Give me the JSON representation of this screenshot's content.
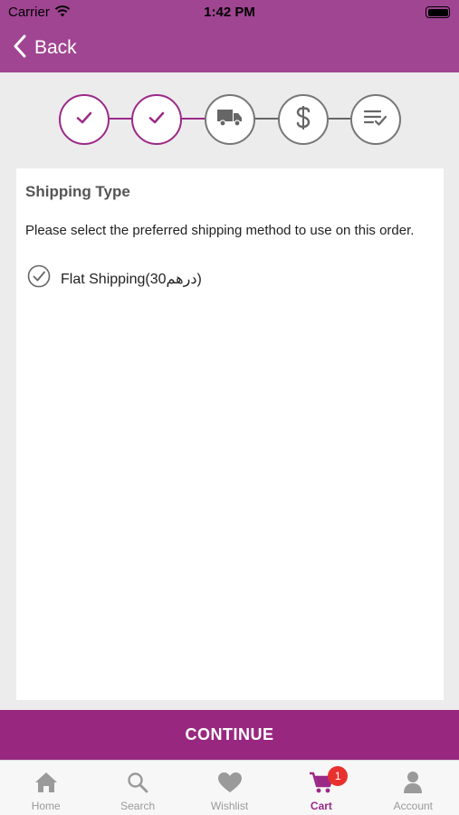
{
  "status_bar": {
    "carrier": "Carrier",
    "time": "1:42 PM"
  },
  "nav": {
    "back_label": "Back"
  },
  "stepper": {
    "steps": [
      {
        "name": "step-address",
        "icon": "check-icon",
        "state": "done"
      },
      {
        "name": "step-delivery",
        "icon": "check-icon",
        "state": "done"
      },
      {
        "name": "step-shipping",
        "icon": "truck-icon",
        "state": "pending"
      },
      {
        "name": "step-payment",
        "icon": "dollar-icon",
        "state": "pending"
      },
      {
        "name": "step-review",
        "icon": "checklist-icon",
        "state": "pending"
      }
    ]
  },
  "card": {
    "title": "Shipping Type",
    "description": "Please select the preferred shipping method to use on this order.",
    "option_label": "Flat Shipping(30درهم)",
    "option_selected": true
  },
  "continue_label": "CONTINUE",
  "tabs": [
    {
      "label": "Home",
      "icon": "home-icon",
      "active": false
    },
    {
      "label": "Search",
      "icon": "search-icon",
      "active": false
    },
    {
      "label": "Wishlist",
      "icon": "heart-icon",
      "active": false
    },
    {
      "label": "Cart",
      "icon": "cart-icon",
      "active": true,
      "badge": "1"
    },
    {
      "label": "Account",
      "icon": "person-icon",
      "active": false
    }
  ],
  "colors": {
    "brand": "#a04592",
    "button": "#98287f",
    "badge": "#e8312f"
  }
}
